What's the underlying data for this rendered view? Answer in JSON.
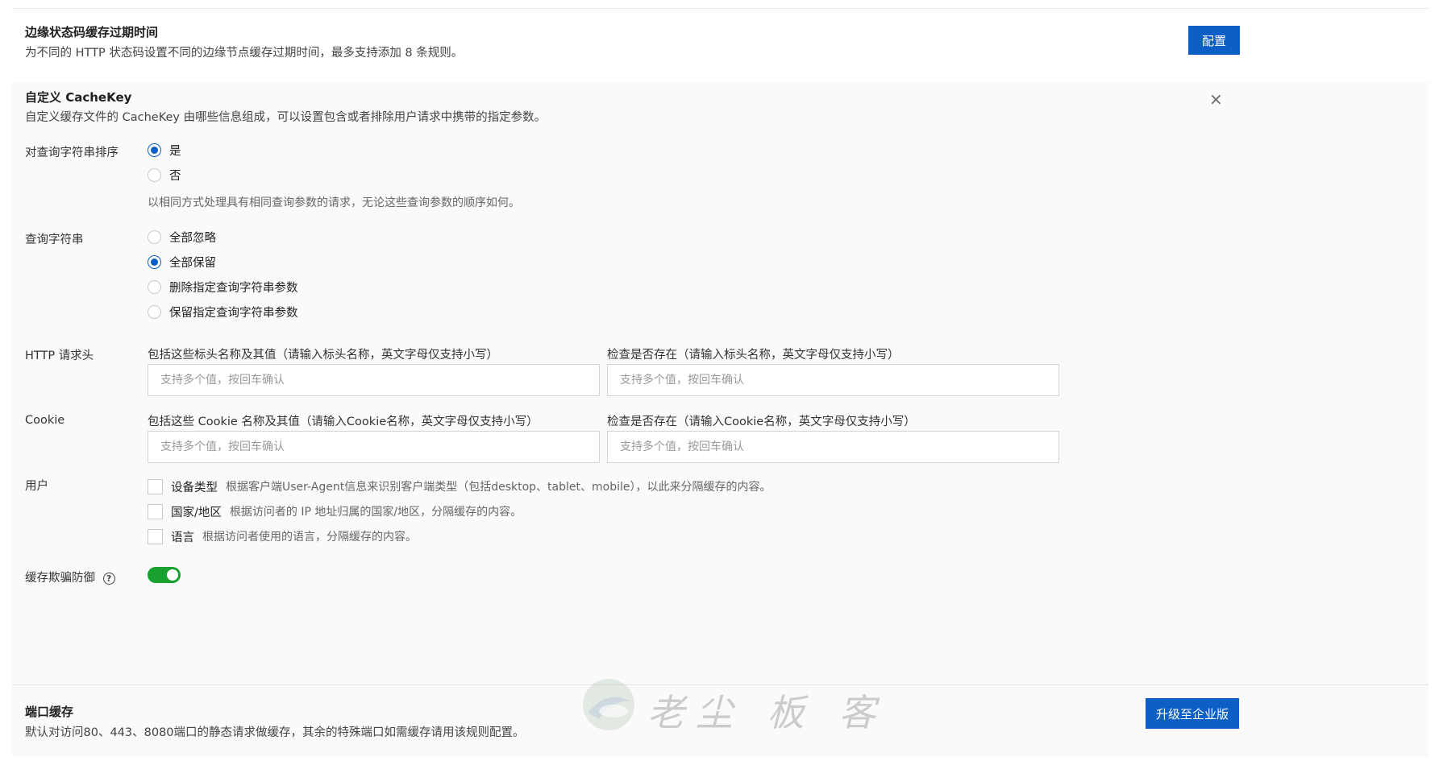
{
  "edge_status_cache": {
    "title": "边缘状态码缓存过期时间",
    "desc": "为不同的 HTTP 状态码设置不同的边缘节点缓存过期时间，最多支持添加 8 条规则。",
    "button": "配置"
  },
  "cachekey": {
    "title": "自定义 CacheKey",
    "desc": "自定义缓存文件的 CacheKey 由哪些信息组成，可以设置包含或者排除用户请求中携带的指定参数。",
    "close_icon": "×",
    "sort_query": {
      "label": "对查询字符串排序",
      "options": [
        "是",
        "否"
      ],
      "selected": 0,
      "hint": "以相同方式处理具有相同查询参数的请求，无论这些查询参数的顺序如何。"
    },
    "query_string": {
      "label": "查询字符串",
      "options": [
        "全部忽略",
        "全部保留",
        "删除指定查询字符串参数",
        "保留指定查询字符串参数"
      ],
      "selected": 1
    },
    "http_header": {
      "label": "HTTP 请求头",
      "include_label": "包括这些标头名称及其值（请输入标头名称，英文字母仅支持小写）",
      "check_label": "检查是否存在（请输入标头名称，英文字母仅支持小写）",
      "include_placeholder": "支持多个值，按回车确认",
      "check_placeholder": "支持多个值，按回车确认"
    },
    "cookie": {
      "label": "Cookie",
      "include_label": "包括这些 Cookie 名称及其值（请输入Cookie名称，英文字母仅支持小写）",
      "check_label": "检查是否存在（请输入Cookie名称，英文字母仅支持小写）",
      "include_placeholder": "支持多个值，按回车确认",
      "check_placeholder": "支持多个值，按回车确认"
    },
    "user": {
      "label": "用户",
      "items": [
        {
          "name": "设备类型",
          "desc": "根据客户端User-Agent信息来识别客户端类型（包括desktop、tablet、mobile），以此来分隔缓存的内容。",
          "checked": false
        },
        {
          "name": "国家/地区",
          "desc": "根据访问者的 IP 地址归属的国家/地区，分隔缓存的内容。",
          "checked": false
        },
        {
          "name": "语言",
          "desc": "根据访问者使用的语言，分隔缓存的内容。",
          "checked": false
        }
      ]
    },
    "cache_deception": {
      "label": "缓存欺骗防御",
      "help_icon": "?",
      "enabled": true
    }
  },
  "port_cache": {
    "title": "端口缓存",
    "desc": "默认对访问80、443、8080端口的静态请求做缓存，其余的特殊端口如需缓存请用该规则配置。",
    "button": "升级至企业版"
  },
  "watermark": "老尘 板 客",
  "colors": {
    "primary": "#0c5fc4",
    "toggle_on": "#18a12e"
  }
}
